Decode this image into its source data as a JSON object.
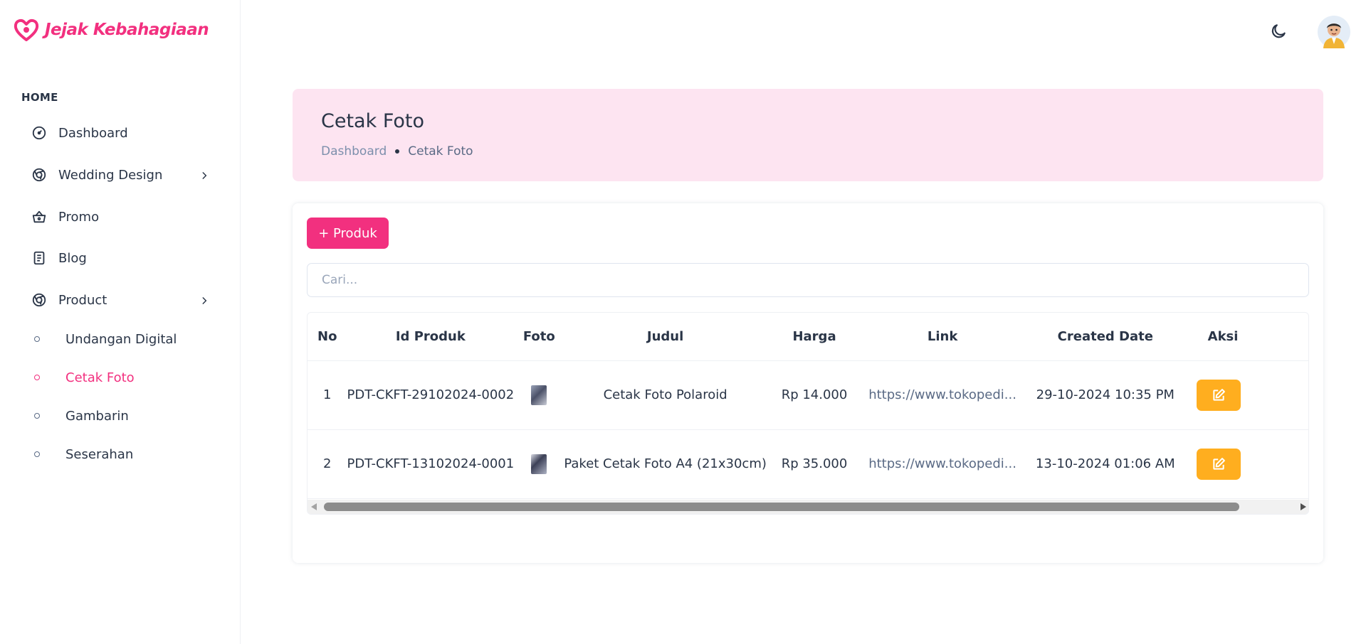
{
  "brand": {
    "name": "Jejak Kebahagiaan",
    "color": "#f2307f"
  },
  "sidebar": {
    "section": "HOME",
    "items": [
      {
        "label": "Dashboard",
        "icon": "gauge-icon"
      },
      {
        "label": "Wedding Design",
        "icon": "aperture-icon",
        "has_children": true
      },
      {
        "label": "Promo",
        "icon": "basket-icon"
      },
      {
        "label": "Blog",
        "icon": "document-icon"
      },
      {
        "label": "Product",
        "icon": "aperture-icon",
        "has_children": true
      }
    ],
    "sub_items": [
      {
        "label": "Undangan Digital",
        "active": false
      },
      {
        "label": "Cetak Foto",
        "active": true
      },
      {
        "label": "Gambarin",
        "active": false
      },
      {
        "label": "Seserahan",
        "active": false
      }
    ]
  },
  "topbar": {
    "theme_toggle_icon": "moon-icon",
    "avatar_icon": "user-avatar"
  },
  "page": {
    "title": "Cetak Foto",
    "breadcrumb": {
      "parent": "Dashboard",
      "current": "Cetak Foto"
    },
    "banner_color": "#fde4f1"
  },
  "toolbar": {
    "add_label": "+ Produk",
    "search_placeholder": "Cari..."
  },
  "table": {
    "columns": [
      "No",
      "Id Produk",
      "Foto",
      "Judul",
      "Harga",
      "Link",
      "Created Date",
      "Aksi"
    ],
    "rows": [
      {
        "no": "1",
        "id": "PDT-CKFT-29102024-0002",
        "judul": "Cetak Foto Polaroid",
        "harga": "Rp 14.000",
        "link": "https://www.tokopedi...",
        "created": "29-10-2024 10:35 PM"
      },
      {
        "no": "2",
        "id": "PDT-CKFT-13102024-0001",
        "judul": "Paket Cetak Foto A4 (21x30cm)",
        "harga": "Rp 35.000",
        "link": "https://www.tokopedi...",
        "created": "13-10-2024 01:06 AM"
      }
    ],
    "edit_button_color": "#ffae1f"
  }
}
